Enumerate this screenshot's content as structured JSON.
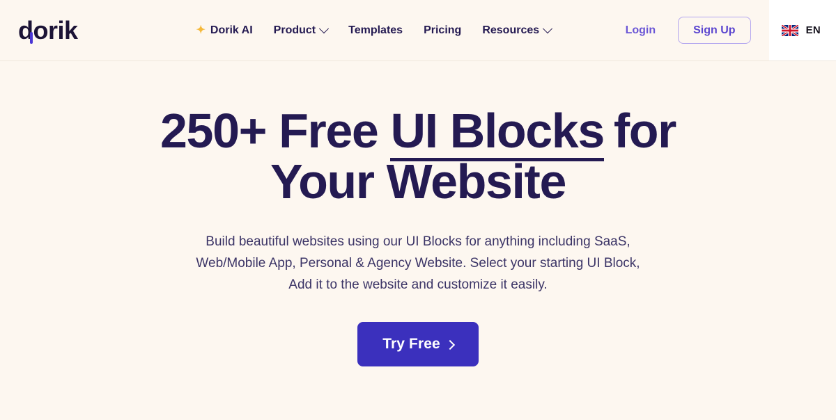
{
  "theme": {
    "background": "#fdf7f0",
    "headline_color": "#241a52",
    "accent_purple": "#3b30bd",
    "link_purple": "#6a56d6",
    "sparkle_gold": "#f5b93b"
  },
  "header": {
    "logo": {
      "text": "dorik",
      "accent_color": "#4b36d4"
    },
    "nav_items": [
      {
        "label": "Dorik AI",
        "icon": "sparkle-icon",
        "has_dropdown": false
      },
      {
        "label": "Product",
        "icon": null,
        "has_dropdown": true
      },
      {
        "label": "Templates",
        "icon": null,
        "has_dropdown": false
      },
      {
        "label": "Pricing",
        "icon": null,
        "has_dropdown": false
      },
      {
        "label": "Resources",
        "icon": null,
        "has_dropdown": true
      }
    ],
    "login_label": "Login",
    "signup_label": "Sign Up",
    "language": {
      "code": "EN",
      "flag": "uk-flag-icon"
    }
  },
  "hero": {
    "title_part1": "250+ Free ",
    "title_highlight": "UI Blocks",
    "title_part2": "for",
    "title_line2": "Your Website",
    "subtitle": "Build beautiful websites using our UI Blocks for anything including SaaS, Web/Mobile App, Personal & Agency Website. Select your starting UI Block, Add it to the website and customize it easily.",
    "cta_label": "Try Free"
  }
}
